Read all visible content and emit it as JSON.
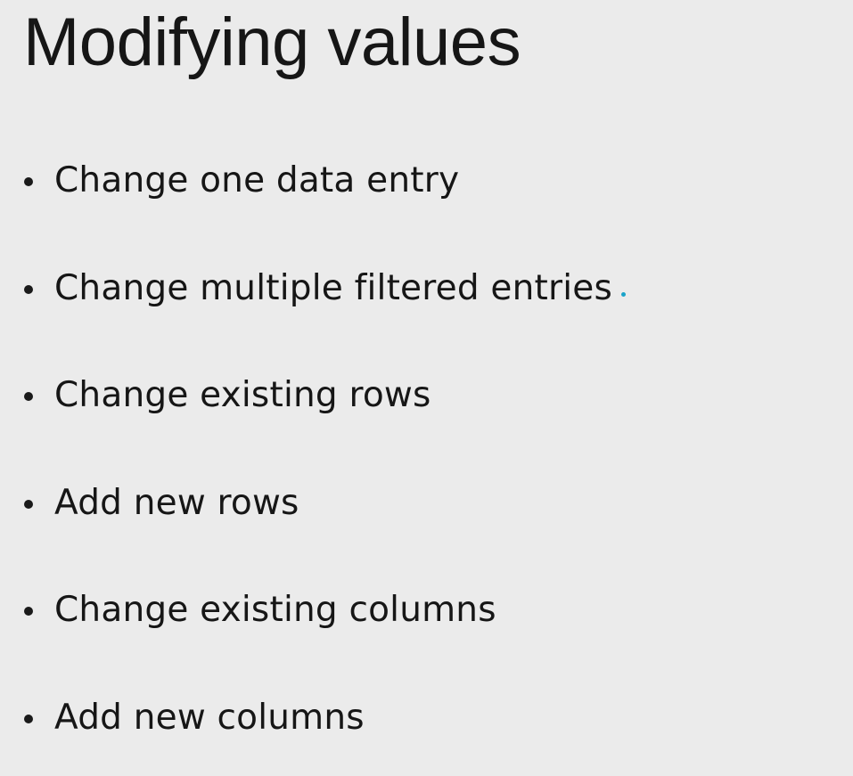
{
  "slide": {
    "title": "Modifying values",
    "bullets": [
      "Change one data entry",
      "Change multiple filtered entries",
      "Change existing rows",
      "Add new rows",
      "Change existing columns",
      "Add new columns"
    ]
  },
  "colors": {
    "background": "#ebebeb",
    "text": "#161616",
    "cursor_mark": "#1aa3c9"
  }
}
